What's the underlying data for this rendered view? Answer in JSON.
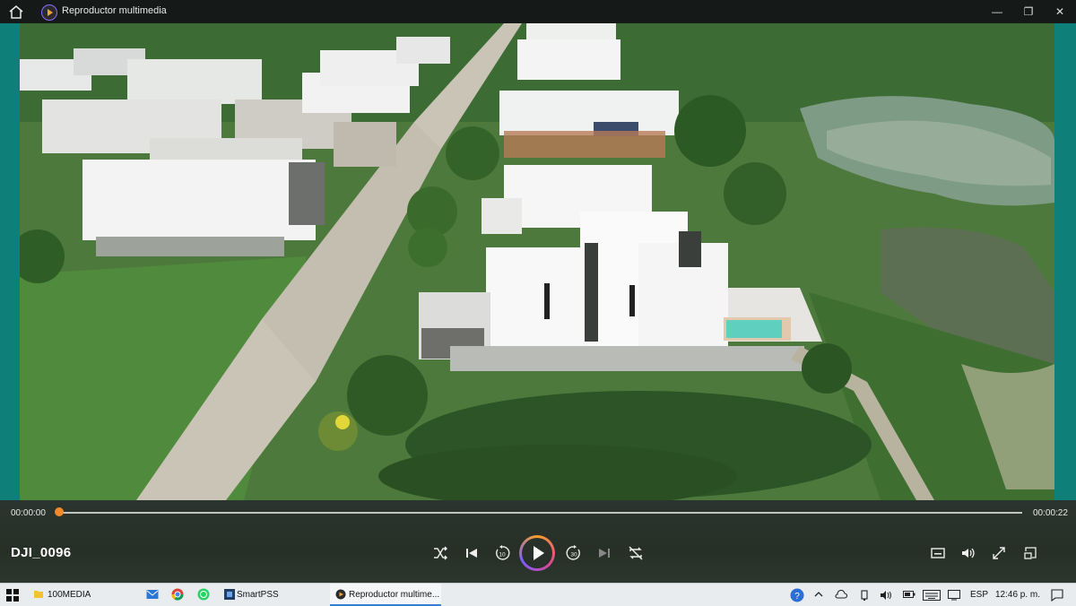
{
  "window": {
    "title": "Reproductor multimedia",
    "icon": "media-player-icon"
  },
  "player": {
    "video_title": "DJI_0096",
    "time_current": "00:00:00",
    "time_total": "00:00:22",
    "progress": 0.0
  },
  "taskbar": {
    "items": [
      {
        "label": "100MEDIA",
        "icon": "folder-icon"
      },
      {
        "label": "SmartPSS",
        "icon": "smartpss-icon"
      },
      {
        "label": "Reproductor multime...",
        "icon": "media-player-icon"
      }
    ],
    "language": "ESP",
    "clock": "12:46 p. m."
  },
  "colors": {
    "accent": "#f08a2a",
    "teal_border": "#0f7f7a",
    "taskbar_active": "#3a7bd5"
  }
}
